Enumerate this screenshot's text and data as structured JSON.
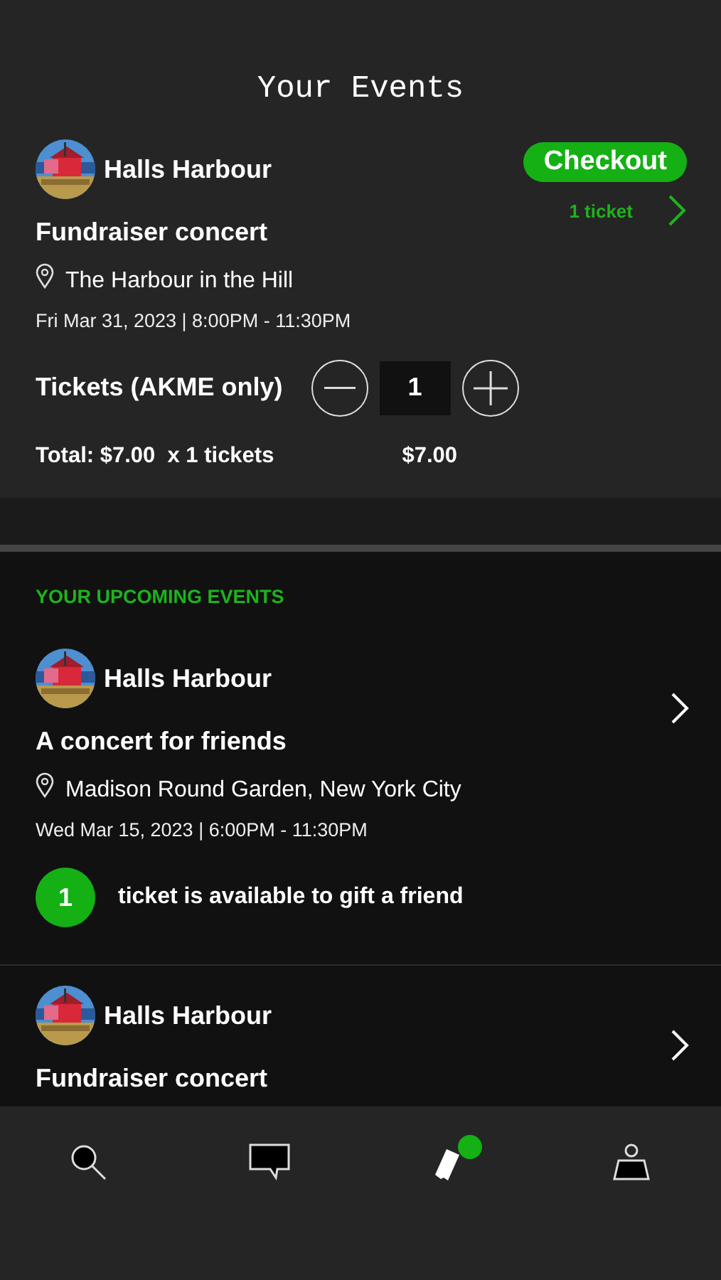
{
  "header": {
    "title": "Your Events"
  },
  "cart": {
    "organizer": "Halls Harbour",
    "event": "Fundraiser concert",
    "venue": "The Harbour in the Hill",
    "datetime": "Fri Mar 31, 2023 | 8:00PM - 11:30PM",
    "checkout": "Checkout",
    "ticket_count": "1 ticket",
    "tickets_label": "Tickets (AKME only)",
    "quantity": "1",
    "total": "Total: $7.00  x 1 tickets",
    "amount": "$7.00"
  },
  "upcoming": {
    "heading": "YOUR UPCOMING EVENTS",
    "events": [
      {
        "organizer": "Halls Harbour",
        "event": "A concert for friends",
        "venue": "Madison Round Garden, New York City",
        "datetime": "Wed Mar 15, 2023 | 6:00PM - 11:30PM",
        "gift_count": "1",
        "gift_text": "ticket is available to gift a friend"
      },
      {
        "organizer": "Halls Harbour",
        "event": "Fundraiser concert"
      }
    ]
  },
  "tabs": [
    {
      "kind": "search",
      "selected": false,
      "notification": false
    },
    {
      "kind": "messages",
      "selected": false,
      "notification": false
    },
    {
      "kind": "tickets",
      "selected": true,
      "notification": true
    },
    {
      "kind": "profile",
      "selected": false,
      "notification": false
    }
  ]
}
